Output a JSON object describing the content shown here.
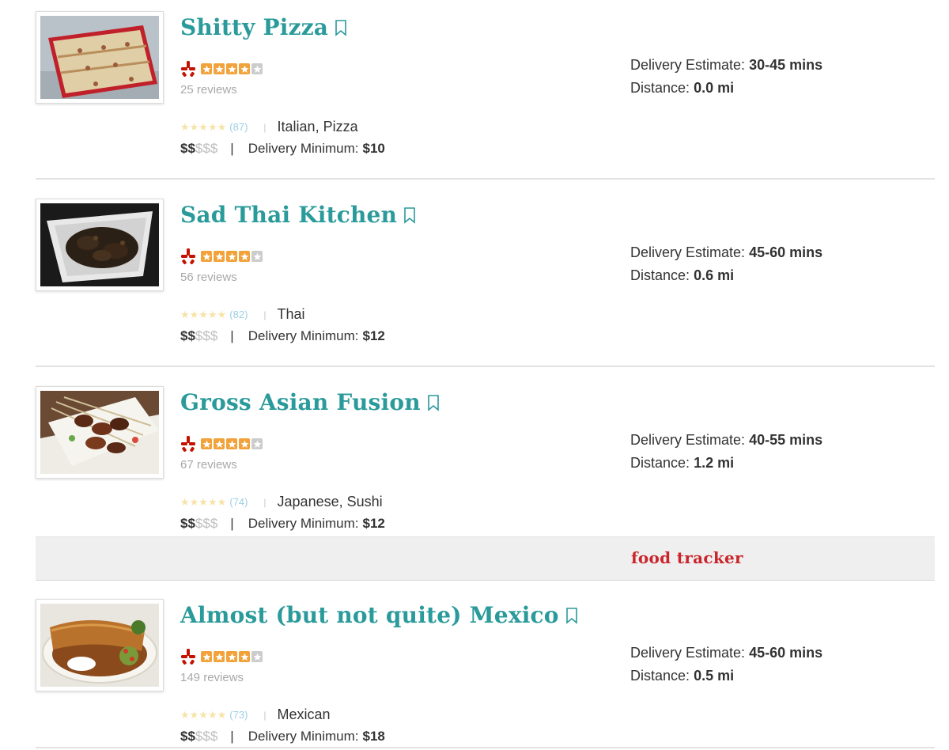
{
  "listings": [
    {
      "name": "Shitty Pizza",
      "yelp_rating": 4,
      "yelp_reviews": "25 reviews",
      "rating_stars": "★★★★★",
      "rating_count": "(87)",
      "cuisine": "Italian, Pizza",
      "price_active": "$$",
      "price_inactive": "$$$",
      "delivery_min_label": "Delivery Minimum:",
      "delivery_min": "$10",
      "delivery_estimate_label": "Delivery Estimate:",
      "delivery_estimate": "30-45 mins",
      "distance_label": "Distance:",
      "distance": "0.0 mi",
      "image": "pizza-photo"
    },
    {
      "name": "Sad Thai Kitchen",
      "yelp_rating": 4,
      "yelp_reviews": "56 reviews",
      "rating_stars": "★★★★★",
      "rating_count": "(82)",
      "cuisine": "Thai",
      "price_active": "$$",
      "price_inactive": "$$$",
      "delivery_min_label": "Delivery Minimum:",
      "delivery_min": "$12",
      "delivery_estimate_label": "Delivery Estimate:",
      "delivery_estimate": "45-60 mins",
      "distance_label": "Distance:",
      "distance": "0.6 mi",
      "image": "thai-dish-photo"
    },
    {
      "name": "Gross Asian Fusion",
      "yelp_rating": 4,
      "yelp_reviews": "67 reviews",
      "rating_stars": "★★★★★",
      "rating_count": "(74)",
      "cuisine": "Japanese, Sushi",
      "price_active": "$$",
      "price_inactive": "$$$",
      "delivery_min_label": "Delivery Minimum:",
      "delivery_min": "$12",
      "delivery_estimate_label": "Delivery Estimate:",
      "delivery_estimate": "40-55 mins",
      "distance_label": "Distance:",
      "distance": "1.2 mi",
      "image": "skewers-photo"
    },
    {
      "name": "Almost (but not quite) Mexico",
      "yelp_rating": 4,
      "yelp_reviews": "149 reviews",
      "rating_stars": "★★★★★",
      "rating_count": "(73)",
      "cuisine": "Mexican",
      "price_active": "$$",
      "price_inactive": "$$$",
      "delivery_min_label": "Delivery Minimum:",
      "delivery_min": "$18",
      "delivery_estimate_label": "Delivery Estimate:",
      "delivery_estimate": "45-60 mins",
      "distance_label": "Distance:",
      "distance": "0.5 mi",
      "image": "burrito-photo"
    }
  ],
  "promo_banner": {
    "text": "food tracker"
  },
  "colors": {
    "restaurant_name": "#2a9a9a",
    "yelp_red": "#c41200",
    "yelp_star": "#f2a23a",
    "yelp_star_empty": "#cccccc",
    "promo_red": "#c9262c"
  },
  "icons": {
    "bookmark": "bookmark-icon",
    "yelp": "yelp-logo-icon"
  }
}
